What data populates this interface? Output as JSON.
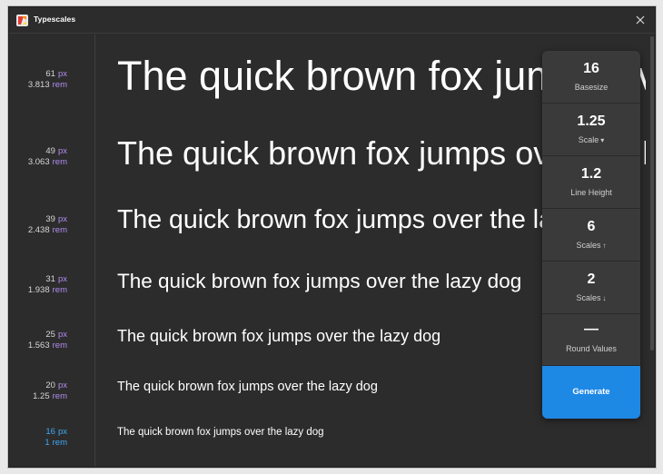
{
  "window": {
    "title": "Typescales"
  },
  "sizes": [
    {
      "px": "61",
      "rem": "3.813",
      "unit_px": "px",
      "unit_rem": "rem"
    },
    {
      "px": "49",
      "rem": "3.063",
      "unit_px": "px",
      "unit_rem": "rem"
    },
    {
      "px": "39",
      "rem": "2.438",
      "unit_px": "px",
      "unit_rem": "rem"
    },
    {
      "px": "31",
      "rem": "1.938",
      "unit_px": "px",
      "unit_rem": "rem"
    },
    {
      "px": "25",
      "rem": "1.563",
      "unit_px": "px",
      "unit_rem": "rem"
    },
    {
      "px": "20",
      "rem": "1.25",
      "unit_px": "px",
      "unit_rem": "rem"
    },
    {
      "px": "16",
      "rem": "1",
      "unit_px": "px",
      "unit_rem": "rem"
    }
  ],
  "sample_text": "The quick brown fox jumps over the lazy dog",
  "controls": {
    "basesize": {
      "value": "16",
      "label": "Basesize"
    },
    "scale": {
      "value": "1.25",
      "label": "Scale",
      "glyph": "▾"
    },
    "line_height": {
      "value": "1.2",
      "label": "Line Height"
    },
    "scales_up": {
      "value": "6",
      "label": "Scales",
      "glyph": "↑"
    },
    "scales_down": {
      "value": "2",
      "label": "Scales",
      "glyph": "↓"
    },
    "round_values": {
      "value": "—",
      "label": "Round Values"
    }
  },
  "generate_label": "Generate",
  "colors": {
    "accent": "#1e88e5",
    "rem_unit": "#b18cf0",
    "base_highlight": "#3fa9f5",
    "background": "#2c2c2c"
  }
}
